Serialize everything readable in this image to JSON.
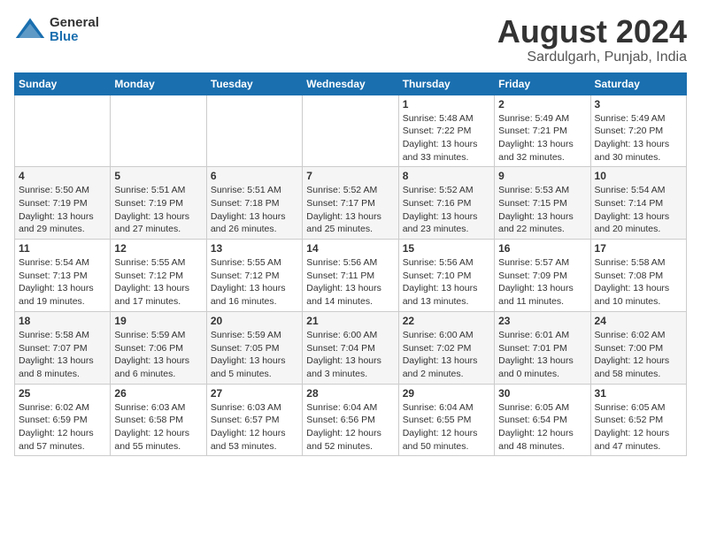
{
  "logo": {
    "general": "General",
    "blue": "Blue"
  },
  "title": "August 2024",
  "location": "Sardulgarh, Punjab, India",
  "days_of_week": [
    "Sunday",
    "Monday",
    "Tuesday",
    "Wednesday",
    "Thursday",
    "Friday",
    "Saturday"
  ],
  "weeks": [
    [
      {
        "day": "",
        "info": ""
      },
      {
        "day": "",
        "info": ""
      },
      {
        "day": "",
        "info": ""
      },
      {
        "day": "",
        "info": ""
      },
      {
        "day": "1",
        "info": "Sunrise: 5:48 AM\nSunset: 7:22 PM\nDaylight: 13 hours\nand 33 minutes."
      },
      {
        "day": "2",
        "info": "Sunrise: 5:49 AM\nSunset: 7:21 PM\nDaylight: 13 hours\nand 32 minutes."
      },
      {
        "day": "3",
        "info": "Sunrise: 5:49 AM\nSunset: 7:20 PM\nDaylight: 13 hours\nand 30 minutes."
      }
    ],
    [
      {
        "day": "4",
        "info": "Sunrise: 5:50 AM\nSunset: 7:19 PM\nDaylight: 13 hours\nand 29 minutes."
      },
      {
        "day": "5",
        "info": "Sunrise: 5:51 AM\nSunset: 7:19 PM\nDaylight: 13 hours\nand 27 minutes."
      },
      {
        "day": "6",
        "info": "Sunrise: 5:51 AM\nSunset: 7:18 PM\nDaylight: 13 hours\nand 26 minutes."
      },
      {
        "day": "7",
        "info": "Sunrise: 5:52 AM\nSunset: 7:17 PM\nDaylight: 13 hours\nand 25 minutes."
      },
      {
        "day": "8",
        "info": "Sunrise: 5:52 AM\nSunset: 7:16 PM\nDaylight: 13 hours\nand 23 minutes."
      },
      {
        "day": "9",
        "info": "Sunrise: 5:53 AM\nSunset: 7:15 PM\nDaylight: 13 hours\nand 22 minutes."
      },
      {
        "day": "10",
        "info": "Sunrise: 5:54 AM\nSunset: 7:14 PM\nDaylight: 13 hours\nand 20 minutes."
      }
    ],
    [
      {
        "day": "11",
        "info": "Sunrise: 5:54 AM\nSunset: 7:13 PM\nDaylight: 13 hours\nand 19 minutes."
      },
      {
        "day": "12",
        "info": "Sunrise: 5:55 AM\nSunset: 7:12 PM\nDaylight: 13 hours\nand 17 minutes."
      },
      {
        "day": "13",
        "info": "Sunrise: 5:55 AM\nSunset: 7:12 PM\nDaylight: 13 hours\nand 16 minutes."
      },
      {
        "day": "14",
        "info": "Sunrise: 5:56 AM\nSunset: 7:11 PM\nDaylight: 13 hours\nand 14 minutes."
      },
      {
        "day": "15",
        "info": "Sunrise: 5:56 AM\nSunset: 7:10 PM\nDaylight: 13 hours\nand 13 minutes."
      },
      {
        "day": "16",
        "info": "Sunrise: 5:57 AM\nSunset: 7:09 PM\nDaylight: 13 hours\nand 11 minutes."
      },
      {
        "day": "17",
        "info": "Sunrise: 5:58 AM\nSunset: 7:08 PM\nDaylight: 13 hours\nand 10 minutes."
      }
    ],
    [
      {
        "day": "18",
        "info": "Sunrise: 5:58 AM\nSunset: 7:07 PM\nDaylight: 13 hours\nand 8 minutes."
      },
      {
        "day": "19",
        "info": "Sunrise: 5:59 AM\nSunset: 7:06 PM\nDaylight: 13 hours\nand 6 minutes."
      },
      {
        "day": "20",
        "info": "Sunrise: 5:59 AM\nSunset: 7:05 PM\nDaylight: 13 hours\nand 5 minutes."
      },
      {
        "day": "21",
        "info": "Sunrise: 6:00 AM\nSunset: 7:04 PM\nDaylight: 13 hours\nand 3 minutes."
      },
      {
        "day": "22",
        "info": "Sunrise: 6:00 AM\nSunset: 7:02 PM\nDaylight: 13 hours\nand 2 minutes."
      },
      {
        "day": "23",
        "info": "Sunrise: 6:01 AM\nSunset: 7:01 PM\nDaylight: 13 hours\nand 0 minutes."
      },
      {
        "day": "24",
        "info": "Sunrise: 6:02 AM\nSunset: 7:00 PM\nDaylight: 12 hours\nand 58 minutes."
      }
    ],
    [
      {
        "day": "25",
        "info": "Sunrise: 6:02 AM\nSunset: 6:59 PM\nDaylight: 12 hours\nand 57 minutes."
      },
      {
        "day": "26",
        "info": "Sunrise: 6:03 AM\nSunset: 6:58 PM\nDaylight: 12 hours\nand 55 minutes."
      },
      {
        "day": "27",
        "info": "Sunrise: 6:03 AM\nSunset: 6:57 PM\nDaylight: 12 hours\nand 53 minutes."
      },
      {
        "day": "28",
        "info": "Sunrise: 6:04 AM\nSunset: 6:56 PM\nDaylight: 12 hours\nand 52 minutes."
      },
      {
        "day": "29",
        "info": "Sunrise: 6:04 AM\nSunset: 6:55 PM\nDaylight: 12 hours\nand 50 minutes."
      },
      {
        "day": "30",
        "info": "Sunrise: 6:05 AM\nSunset: 6:54 PM\nDaylight: 12 hours\nand 48 minutes."
      },
      {
        "day": "31",
        "info": "Sunrise: 6:05 AM\nSunset: 6:52 PM\nDaylight: 12 hours\nand 47 minutes."
      }
    ]
  ]
}
